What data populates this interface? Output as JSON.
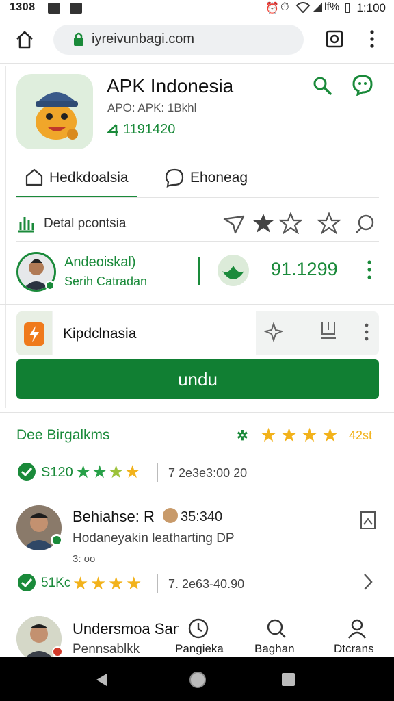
{
  "status": {
    "time_left": "1308",
    "time_right": "1:100",
    "signal": "lf%"
  },
  "browser": {
    "url": "iyreivunbagi.com"
  },
  "app": {
    "title": "APK Indonesia",
    "subtitle": "APO: APK: 1Bkhl",
    "count": "1191420"
  },
  "tabs": [
    {
      "label": "Hedkdoalsia"
    },
    {
      "label": "Ehoneag"
    }
  ],
  "detail_row": {
    "label": "Detal pcontsia"
  },
  "developer": {
    "name": "Andeoiskal)",
    "sub": "Serih Catradan",
    "score": "91.1299"
  },
  "card": {
    "label": "Kipdclnasia"
  },
  "download": {
    "label": "undu"
  },
  "reviews_header": {
    "label": "Dee Birgalkms",
    "rating_text": "42st"
  },
  "summary": {
    "count": "S120",
    "date": "7 2e3e3:00 20"
  },
  "reviews": [
    {
      "name": "Behiahse: R",
      "badge": "35:340",
      "text": "Hodaneyakin leatharting  DP",
      "meta": "3: oo",
      "count": "51Kc",
      "date": "7. 2e63-40.90"
    },
    {
      "name": "Undersmoa San",
      "text": "Pennsablkk"
    }
  ],
  "bottom_tabs": [
    {
      "label": "Pangieka"
    },
    {
      "label": "Baghan"
    },
    {
      "label": "Dtcrans"
    }
  ],
  "colors": {
    "accent": "#1a8a3a",
    "button": "#117f33",
    "star": "#f2b21b"
  }
}
